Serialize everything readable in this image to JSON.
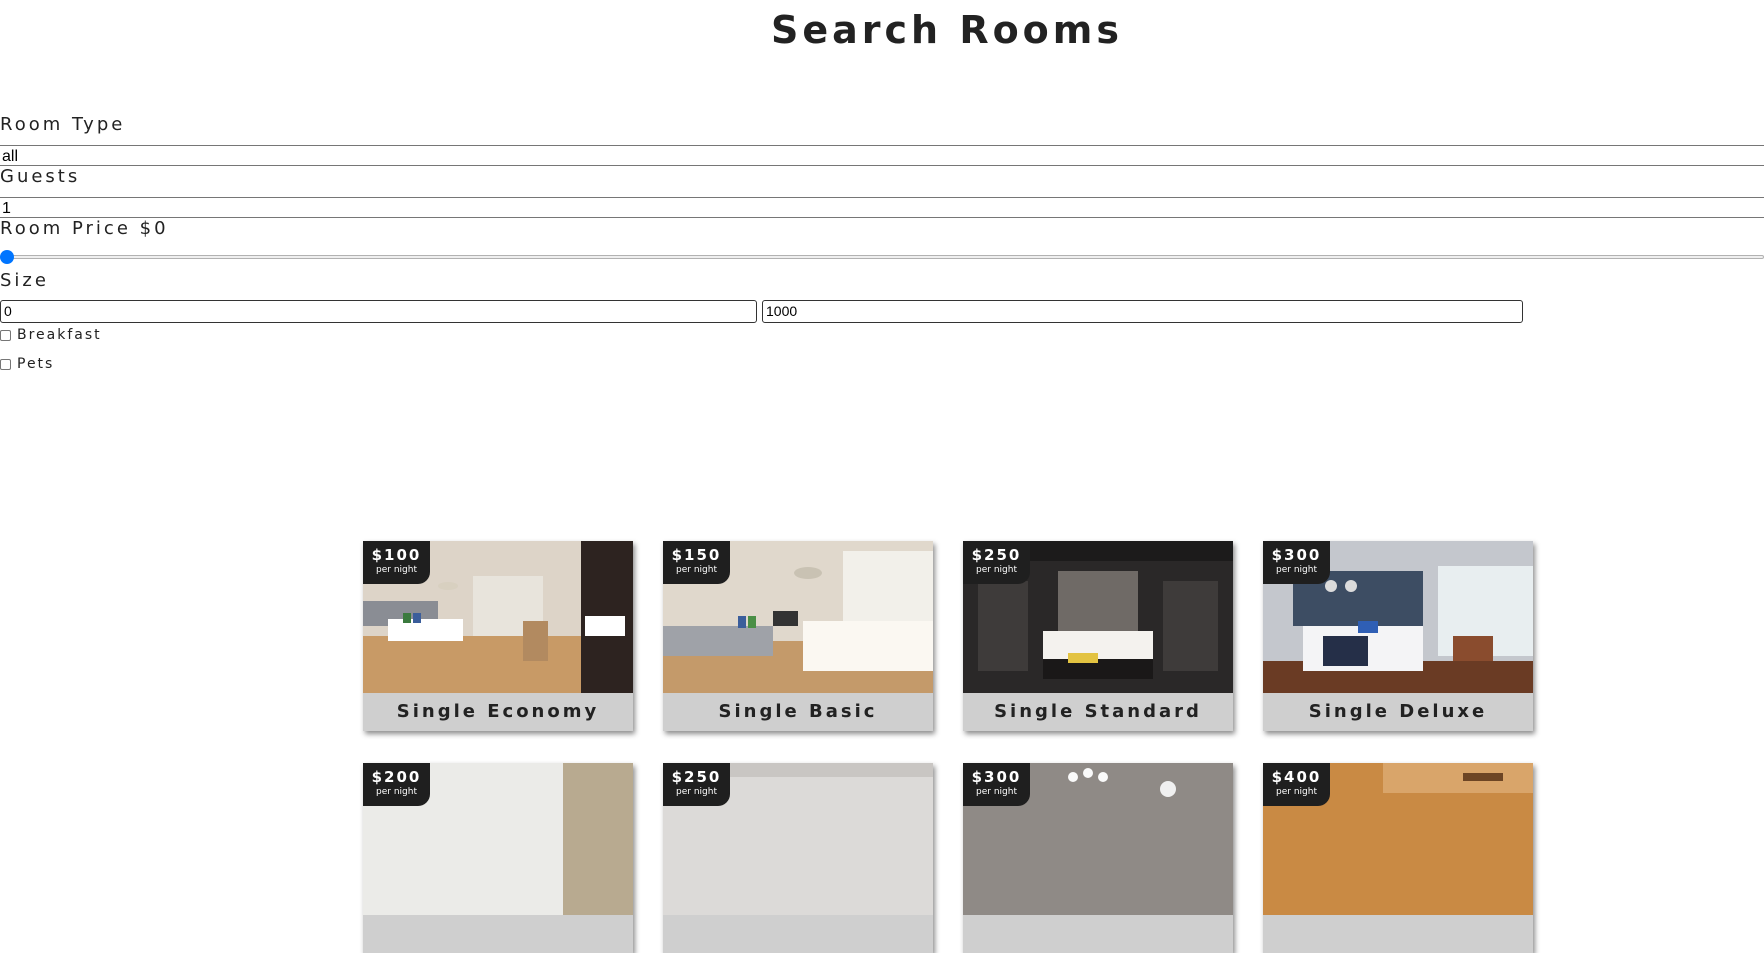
{
  "page": {
    "title": "Search Rooms"
  },
  "filters": {
    "room_type": {
      "label": "Room Type",
      "value": "all"
    },
    "guests": {
      "label": "Guests",
      "value": "1"
    },
    "price": {
      "label": "Room Price $0",
      "value": 0
    },
    "size": {
      "label": "Size",
      "min": "0",
      "max": "1000"
    },
    "breakfast": {
      "label": "Breakfast",
      "checked": false
    },
    "pets": {
      "label": "Pets",
      "checked": false
    }
  },
  "rooms": [
    {
      "name": "Single Economy",
      "price": "$100",
      "unit": "per night"
    },
    {
      "name": "Single Basic",
      "price": "$150",
      "unit": "per night"
    },
    {
      "name": "Single Standard",
      "price": "$250",
      "unit": "per night"
    },
    {
      "name": "Single Deluxe",
      "price": "$300",
      "unit": "per night"
    },
    {
      "name": "",
      "price": "$200",
      "unit": "per night"
    },
    {
      "name": "",
      "price": "$250",
      "unit": "per night"
    },
    {
      "name": "",
      "price": "$300",
      "unit": "per night"
    },
    {
      "name": "",
      "price": "$400",
      "unit": "per night"
    }
  ],
  "colors": {
    "accent": "#0075ff",
    "price_tag": "#1f1f1f",
    "card_footer": "#cfcfcf"
  }
}
